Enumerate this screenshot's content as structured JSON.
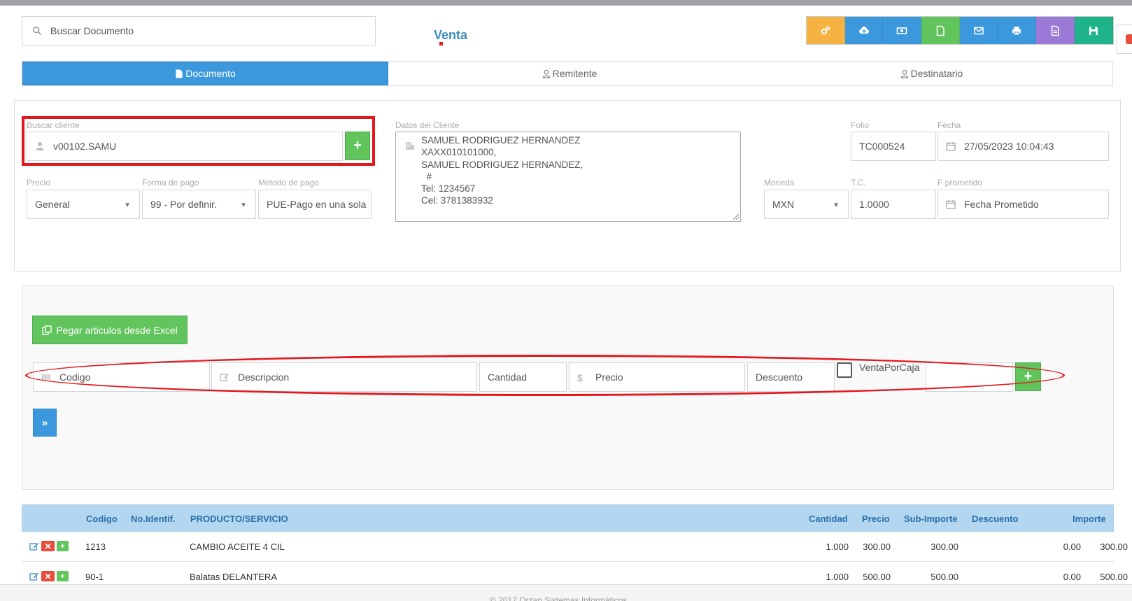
{
  "search": {
    "placeholder": "Buscar Documento"
  },
  "page": {
    "title": "Venta"
  },
  "toolbar": {
    "buttons": [
      {
        "icon": "gears-icon",
        "color": "#f5b441"
      },
      {
        "icon": "cloud-upload-icon",
        "color": "#3c98dc"
      },
      {
        "icon": "money-icon",
        "color": "#3c98dc"
      },
      {
        "icon": "file-icon",
        "color": "#62c45c"
      },
      {
        "icon": "envelope-icon",
        "color": "#3c98dc"
      },
      {
        "icon": "print-icon",
        "color": "#3c98dc"
      },
      {
        "icon": "document-icon",
        "color": "#9b79d6"
      },
      {
        "icon": "save-icon",
        "color": "#1fb38a"
      }
    ]
  },
  "tabs": [
    {
      "label": "Documento",
      "active": true
    },
    {
      "label": "Remitente",
      "active": false
    },
    {
      "label": "Destinatario",
      "active": false
    }
  ],
  "form": {
    "buscar_cliente_label": "Buscar cliente",
    "buscar_cliente_value": "v00102.SAMU",
    "datos_cliente_label": "Datos del Cliente",
    "datos_cliente_lines": [
      "SAMUEL RODRIGUEZ HERNANDEZ",
      "XAXX010101000,",
      "SAMUEL RODRIGUEZ HERNANDEZ,",
      "  #",
      "Tel: 1234567",
      "Cel: 3781383932"
    ],
    "folio_label": "Folio",
    "folio_value": "TC000524",
    "fecha_label": "Fecha",
    "fecha_value": "27/05/2023 10:04:43",
    "precio_label": "Precio",
    "precio_value": "General",
    "forma_pago_label": "Forma de pago",
    "forma_pago_value": "99 - Por definir.",
    "metodo_pago_label": "Metodo de pago",
    "metodo_pago_value": "PUE-Pago en una sola",
    "moneda_label": "Moneda",
    "moneda_value": "MXN",
    "tc_label": "T.C.",
    "tc_value": "1.0000",
    "fprometido_label": "F prometido",
    "fprometido_placeholder": "Fecha Prometido"
  },
  "articles": {
    "paste_excel_label": "Pegar articulos desde Excel",
    "codigo_placeholder": "Codigo",
    "descripcion_placeholder": "Descripcion",
    "cantidad_placeholder": "Cantidad",
    "precio_placeholder": "Precio",
    "descuento_placeholder": "Descuento",
    "venta_por_caja_label": "VentaPorCaja"
  },
  "table": {
    "headers": {
      "codigo": "Codigo",
      "no_identif": "No.Identif.",
      "producto": "PRODUCTO/SERVICIO",
      "cantidad": "Cantidad",
      "precio": "Precio",
      "sub_importe": "Sub-Importe",
      "descuento": "Descuento",
      "importe": "Importe"
    },
    "rows": [
      {
        "codigo": "1213",
        "no_identif": "",
        "producto": "CAMBIO ACEITE 4 CIL",
        "cantidad": "1.000",
        "precio": "300.00",
        "sub_importe": "300.00",
        "descuento": "0.00",
        "importe": "300.00"
      },
      {
        "codigo": "90-1",
        "no_identif": "",
        "producto": "Balatas DELANTERA",
        "cantidad": "1.000",
        "precio": "500.00",
        "sub_importe": "500.00",
        "descuento": "0.00",
        "importe": "500.00"
      }
    ]
  },
  "footer": {
    "text": "© 2017 Orzan Sistemas Informáticos"
  }
}
